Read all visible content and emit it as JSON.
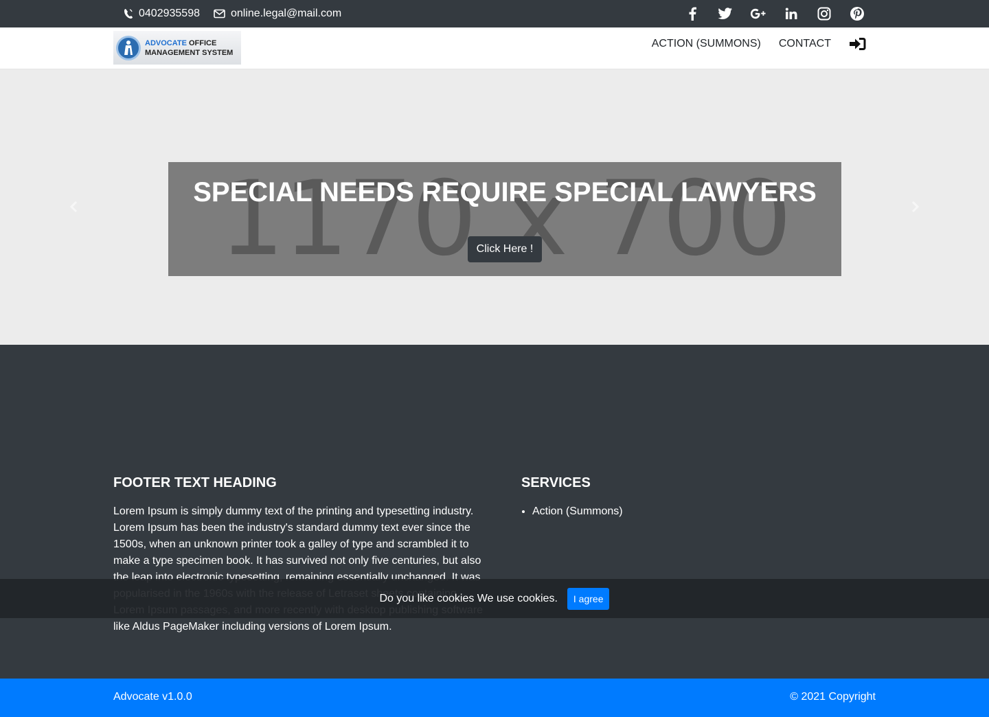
{
  "topbar": {
    "phone": "0402935598",
    "email": "online.legal@mail.com",
    "social": [
      "facebook-icon",
      "twitter-icon",
      "google-plus-icon",
      "linkedin-icon",
      "instagram-icon",
      "pinterest-icon"
    ]
  },
  "navbar": {
    "logo_line1_a": "ADVOCATE",
    "logo_line1_b": "OFFICE",
    "logo_line2": "MANAGEMENT SYSTEM",
    "items": [
      "ACTION (SUMMONS)",
      "CONTACT"
    ],
    "login_icon": "sign-in-icon"
  },
  "hero": {
    "placeholder": "1170 x 700",
    "title": "SPECIAL NEEDS REQUIRE SPECIAL LAWYERS",
    "button": "Click Here !"
  },
  "footer": {
    "col1_heading": "FOOTER TEXT HEADING",
    "col1_text": "Lorem Ipsum is simply dummy text of the printing and typesetting industry. Lorem Ipsum has been the industry's standard dummy text ever since the 1500s, when an unknown printer took a galley of type and scrambled it to make a type specimen book. It has survived not only five centuries, but also the leap into electronic typesetting, remaining essentially unchanged. It was popularised in the 1960s with the release of Letraset sheets containing Lorem Ipsum passages, and more recently with desktop publishing software like Aldus PageMaker including versions of Lorem Ipsum.",
    "col2_heading": "SERVICES",
    "services": [
      "Action (Summons)"
    ]
  },
  "cookie": {
    "text": "Do you like cookies We use cookies.",
    "button": "I agree"
  },
  "bottombar": {
    "version": "Advocate v1.0.0",
    "copyright": "© 2021 Copyright"
  },
  "colors": {
    "dark": "#343a40",
    "primary": "#007bff",
    "hero_bg": "#ececec"
  }
}
